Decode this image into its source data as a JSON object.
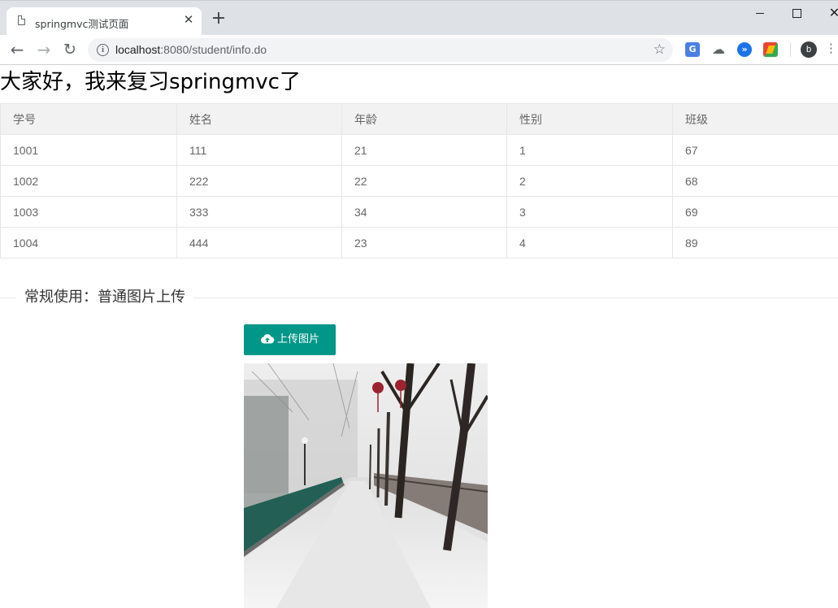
{
  "browser": {
    "tab_title": "springmvc测试页面",
    "url_host": "localhost",
    "url_rest": ":8080/student/info.do",
    "avatar_letter": "b",
    "icons": [
      "file-icon",
      "close-icon",
      "plus-icon",
      "back-icon",
      "forward-icon",
      "reload-icon",
      "info-icon",
      "star-icon",
      "translate-icon",
      "cloud-icon",
      "arrows-icon",
      "color-extension-icon",
      "avatar",
      "menu-icon"
    ]
  },
  "page": {
    "heading": "大家好，我来复习springmvc了",
    "table": {
      "headers": [
        "学号",
        "姓名",
        "年龄",
        "性别",
        "班级"
      ],
      "rows": [
        [
          "1001",
          "111",
          "21",
          "1",
          "67"
        ],
        [
          "1002",
          "222",
          "22",
          "2",
          "68"
        ],
        [
          "1003",
          "333",
          "34",
          "3",
          "69"
        ],
        [
          "1004",
          "444",
          "23",
          "4",
          "89"
        ]
      ]
    },
    "legend": "常规使用：普通图片上传",
    "upload_button": "上传图片",
    "accent_color": "#009688"
  }
}
